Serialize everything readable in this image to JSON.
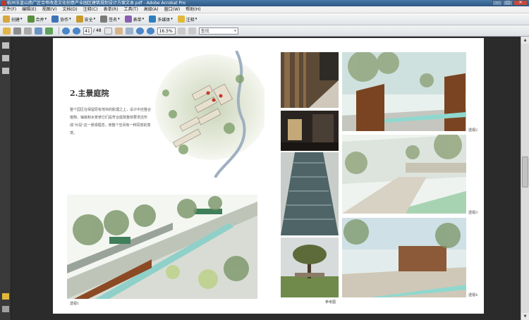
{
  "window": {
    "title": "杭州玉皇山南广区合帝改造文化创意产业园区建筑规划设计方案文本.pdf - Adobe Acrobat Pro"
  },
  "menu": [
    "文件(F)",
    "编辑(E)",
    "视图(V)",
    "文档(D)",
    "注释(C)",
    "表单(R)",
    "工具(T)",
    "高级(A)",
    "窗口(W)",
    "帮助(H)"
  ],
  "toolbar": {
    "create": "创建",
    "combine": "合并",
    "collaborate": "协作",
    "secure": "安全",
    "sign": "签名",
    "forms": "表单",
    "multimedia": "多媒体",
    "comment": "注释"
  },
  "nav": {
    "current_page": "41",
    "total_pages": "/ 48",
    "zoom": "16.5%",
    "find_placeholder": "查找"
  },
  "document": {
    "heading": "2.主景庭院",
    "paragraph": "整个园区在保留原有地块的肌理之上，设计中还整合了植物、铺装和水景使它们是符合庭院整体要求还形成\"片段\"这一景观理念，使整个空间有一种冥想的意境。",
    "captions": {
      "view1": "透视1",
      "view2": "透视2",
      "view3": "透视3",
      "view4": "透视4",
      "reference": "参考图"
    }
  }
}
